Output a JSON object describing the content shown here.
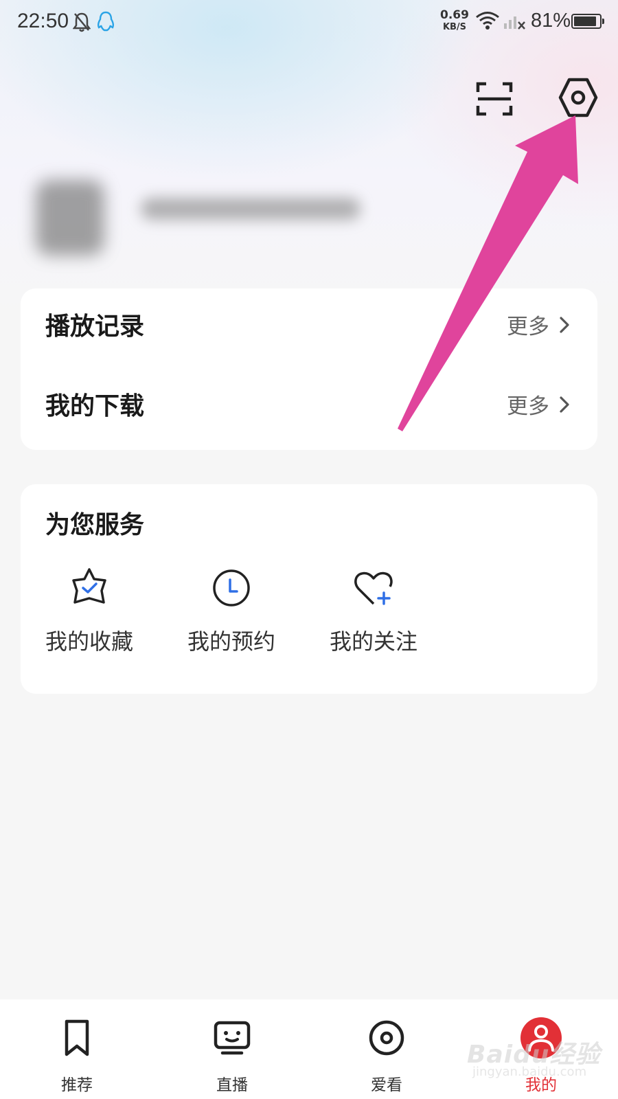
{
  "status_bar": {
    "time": "22:50",
    "net_speed_value": "0.69",
    "net_speed_unit": "KB/S",
    "battery_percent": "81%",
    "battery_level": 0.81
  },
  "header": {
    "scan_icon": "scan-icon",
    "settings_icon": "hexagon-settings-icon"
  },
  "history_card": {
    "rows": [
      {
        "title": "播放记录",
        "more": "更多"
      },
      {
        "title": "我的下载",
        "more": "更多"
      }
    ]
  },
  "services_card": {
    "title": "为您服务",
    "items": [
      {
        "label": "我的收藏",
        "icon": "star-check-icon"
      },
      {
        "label": "我的预约",
        "icon": "clock-icon"
      },
      {
        "label": "我的关注",
        "icon": "heart-plus-icon"
      }
    ]
  },
  "bottom_nav": {
    "items": [
      {
        "label": "推荐",
        "icon": "bookmark-icon"
      },
      {
        "label": "直播",
        "icon": "tv-face-icon"
      },
      {
        "label": "爱看",
        "icon": "disc-icon"
      },
      {
        "label": "我的",
        "icon": "profile-icon"
      }
    ],
    "active_index": 3
  },
  "watermark": {
    "brand": "Baidu经验",
    "url": "jingyan.baidu.com"
  },
  "colors": {
    "accent_red": "#e23036",
    "annotation_arrow": "#e0449c",
    "icon_blue": "#2f6fe6"
  }
}
